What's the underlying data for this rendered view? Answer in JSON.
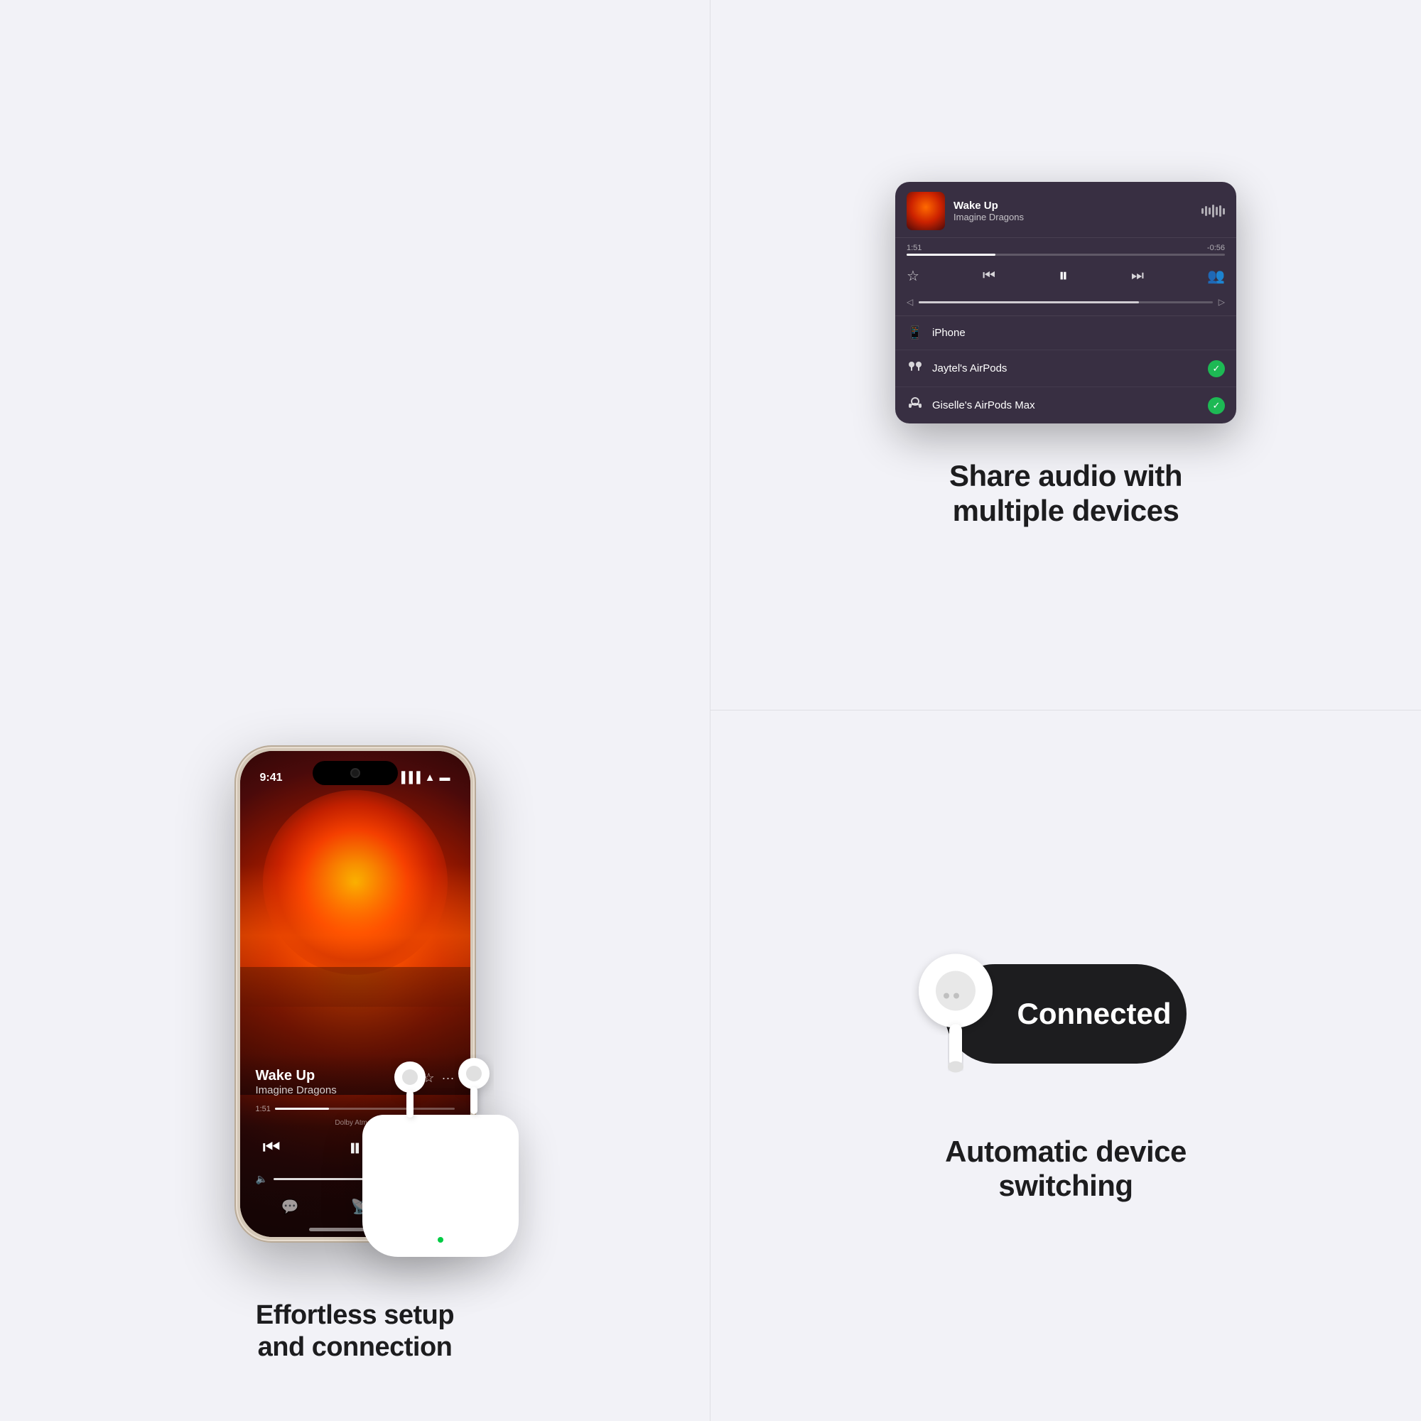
{
  "left": {
    "song_title": "Wake Up",
    "song_artist": "Imagine Dragons",
    "time_current": "1:51",
    "dolby": "Dolby Atmos",
    "caption_line1": "Effortless setup",
    "caption_line2": "and connection",
    "status_time": "9:41"
  },
  "right_top": {
    "card": {
      "song_title": "Wake Up",
      "song_artist": "Imagine Dragons",
      "time_elapsed": "1:51",
      "time_remaining": "-0:56"
    },
    "devices": [
      {
        "name": "iPhone",
        "icon": "📱",
        "checked": false
      },
      {
        "name": "Jaytel's AirPods",
        "icon": "🎧",
        "checked": true
      },
      {
        "name": "Giselle's AirPods Max",
        "icon": "🎧",
        "checked": true
      }
    ],
    "share_line1": "Share audio with",
    "share_line2": "multiple devices"
  },
  "right_bottom": {
    "connected_label": "Connected",
    "switching_line1": "Automatic device",
    "switching_line2": "switching"
  }
}
